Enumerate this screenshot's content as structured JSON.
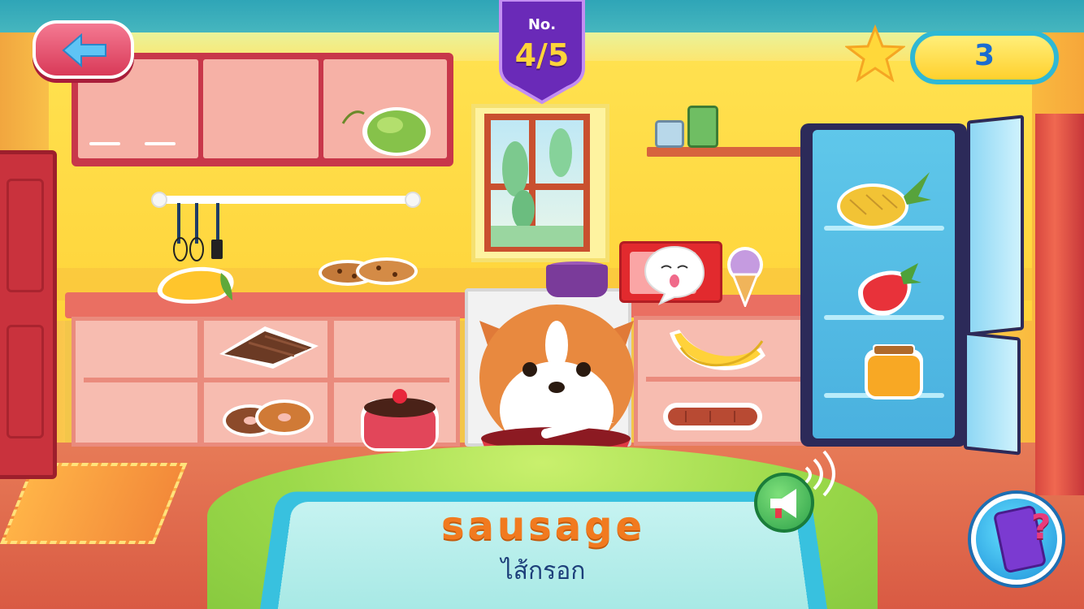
{
  "hud": {
    "back_button_icon": "arrow-left-icon",
    "level_label": "No.",
    "level_count": "4/5",
    "score": "3",
    "score_icon": "star-icon",
    "help_icon": "phone-question-icon",
    "speaker_icon": "megaphone-icon"
  },
  "word_card": {
    "english": "sausage",
    "thai": "ไส้กรอก"
  },
  "items": [
    {
      "name": "coconut",
      "location": "upper-cabinet"
    },
    {
      "name": "mango",
      "location": "counter"
    },
    {
      "name": "cookies",
      "location": "counter"
    },
    {
      "name": "chocolate",
      "location": "lower-shelf"
    },
    {
      "name": "donuts",
      "location": "lower-shelf"
    },
    {
      "name": "cake",
      "location": "lower-shelf"
    },
    {
      "name": "banana",
      "location": "right-shelf"
    },
    {
      "name": "sausage",
      "location": "right-shelf"
    },
    {
      "name": "ice-cream",
      "location": "counter"
    },
    {
      "name": "pineapple",
      "location": "fridge"
    },
    {
      "name": "strawberry",
      "location": "fridge"
    },
    {
      "name": "honey",
      "location": "fridge"
    }
  ],
  "colors": {
    "word_en": "#f17a1f",
    "word_th": "#1d3f7a",
    "score_text": "#1b6cd1",
    "badge": "#6a2ab8"
  }
}
